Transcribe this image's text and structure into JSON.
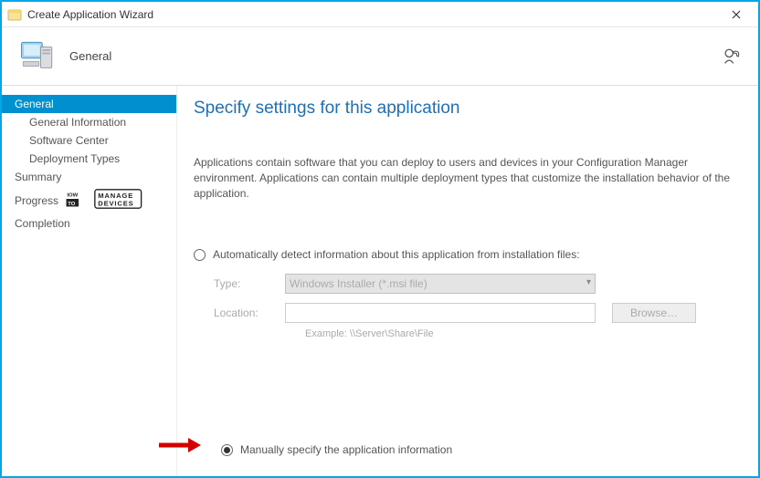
{
  "window": {
    "title": "Create Application Wizard"
  },
  "header": {
    "page_label": "General"
  },
  "sidebar": {
    "items": [
      {
        "label": "General",
        "selected": true,
        "sub": false
      },
      {
        "label": "General Information",
        "selected": false,
        "sub": true
      },
      {
        "label": "Software Center",
        "selected": false,
        "sub": true
      },
      {
        "label": "Deployment Types",
        "selected": false,
        "sub": true
      },
      {
        "label": "Summary",
        "selected": false,
        "sub": false
      },
      {
        "label": "Progress",
        "selected": false,
        "sub": false
      },
      {
        "label": "Completion",
        "selected": false,
        "sub": false
      }
    ],
    "watermark_lines": [
      "IOW",
      "TO",
      "MANAGE",
      "DEVICES"
    ]
  },
  "main": {
    "heading": "Specify settings for this application",
    "description": "Applications contain software that you can deploy to users and devices in your Configuration Manager environment. Applications can contain multiple deployment types that customize the installation behavior of the application.",
    "radio_auto_label": "Automatically detect information about this application from installation files:",
    "radio_manual_label": "Manually specify the application information",
    "radio_selected": "manual",
    "type_label": "Type:",
    "type_value": "Windows Installer (*.msi file)",
    "location_label": "Location:",
    "location_value": "",
    "browse_label": "Browse…",
    "example_label": "Example: \\\\Server\\Share\\File"
  }
}
